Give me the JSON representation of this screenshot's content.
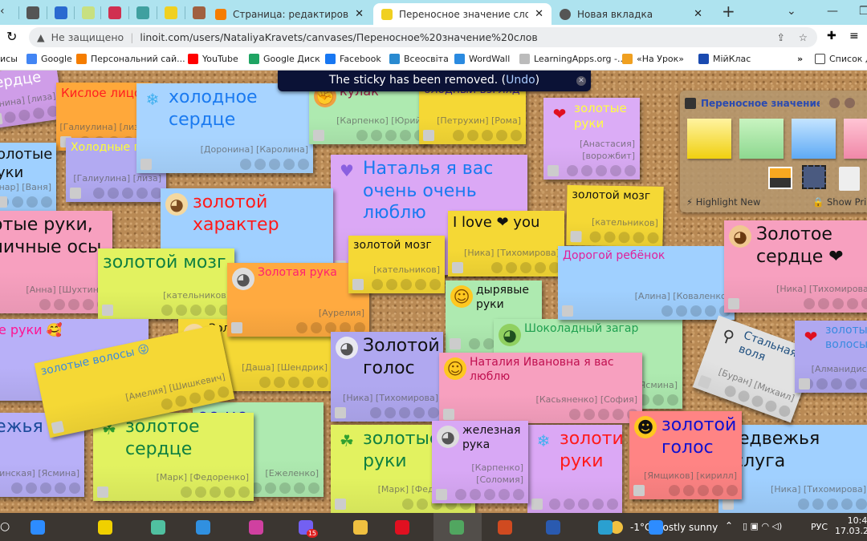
{
  "browser": {
    "pinned_tabs": [
      {
        "icon": "globe",
        "color": "#555"
      },
      {
        "icon": "app-blue",
        "color": "#2a6ad0"
      },
      {
        "icon": "flower",
        "color": "#c8e080"
      },
      {
        "icon": "chart",
        "color": "#d03050"
      },
      {
        "icon": "ribbon",
        "color": "#40a0a0"
      },
      {
        "icon": "linoit",
        "color": "#f0d020"
      },
      {
        "icon": "people",
        "color": "#a06040"
      }
    ],
    "tabs": [
      {
        "title": "Страница: редактирование",
        "icon": "blogger",
        "color": "#f57d00"
      },
      {
        "title": "Переносное значение слов - linoit",
        "icon": "linoit",
        "color": "#f0d020",
        "active": true
      },
      {
        "title": "Новая вкладка",
        "icon": "chrome",
        "color": "#555"
      }
    ],
    "new_tab": "+",
    "security": "Не защищено",
    "url": "linoit.com/users/NataliyaKravets/canvases/Переносное%20значение%20слов",
    "bookmarks": [
      {
        "label": "исы",
        "color": ""
      },
      {
        "label": "Google",
        "color": "#4285f4"
      },
      {
        "label": "Персональний сай...",
        "color": "#f57d00"
      },
      {
        "label": "YouTube",
        "color": "#ff0000"
      },
      {
        "label": "Google Диск",
        "color": "#1fa463"
      },
      {
        "label": "Facebook",
        "color": "#1877f2"
      },
      {
        "label": "Всеосвіта",
        "color": "#2a8ad0"
      },
      {
        "label": "WordWall",
        "color": "#2a8ae0"
      },
      {
        "label": "LearningApps.org -...",
        "color": "#bbb"
      },
      {
        "label": "«На Урок»",
        "color": "#f0a020"
      },
      {
        "label": "МійКлас",
        "color": "#1a4ab0"
      }
    ],
    "more": "»",
    "reading_list": "Список д"
  },
  "toast": {
    "message": "The sticky has been removed. (",
    "undo": "Undo",
    ")": ")"
  },
  "panel": {
    "title": "Переносное значение слов",
    "swatches": [
      "#f7e35a",
      "#a4e6a4",
      "#8ec8ff",
      "#f59ab6"
    ],
    "highlight": "Highlight New",
    "show_private": "Show Pri"
  },
  "board": {
    "stickies": [
      {
        "text": "сердце",
        "author": "[нина] [лиза]",
        "bg": "#cf9de8",
        "color": "#ffffff",
        "icon": ""
      },
      {
        "text": "Кислое лицо",
        "author": "[Галиулина] [лиза]",
        "bg": "#ffa83a",
        "color": "#ff2020",
        "icon": ""
      },
      {
        "text": "олотые уки",
        "author": "[нар] [Ваня]",
        "bg": "#9fd0ff",
        "color": "#111111",
        "icon": ""
      },
      {
        "text": "Холодные г",
        "author": "[Галиулина] [лиза]",
        "bg": "#b2aaf2",
        "color": "#ffff33",
        "icon": ""
      },
      {
        "text": "холодное сердце",
        "author": "[Доронина] [Каролина]",
        "bg": "#a8d4ff",
        "color": "#1a7af0",
        "icon": "snowflake"
      },
      {
        "text": "кулак",
        "author": "[Карпенко] [Юрий]",
        "bg": "#aeeab0",
        "color": "#a0204a",
        "icon": "fist"
      },
      {
        "text": "олодный взгляд",
        "author": "[Петрухин] [Рома]",
        "bg": "#f5d835",
        "color": "#4020a0",
        "icon": ""
      },
      {
        "text": "золотые руки",
        "author": "[Анастасия] [ворожбит]",
        "bg": "#dbacf6",
        "color": "#ffff40",
        "icon": "heart"
      },
      {
        "text": "Наталья я вас очень очень люблю",
        "author": "",
        "bg": "#dba8f5",
        "color": "#1a7af0",
        "icon": "purple-heart"
      },
      {
        "text": "золотой характер",
        "author": "",
        "bg": "#a0d0ff",
        "color": "#ff1a1a",
        "icon": "dog"
      },
      {
        "text": "лотые руки, еничные осы",
        "author": "[Анна] [Шухтина]",
        "bg": "#f7a0bf",
        "color": "#111111",
        "icon": ""
      },
      {
        "text": "золотой мозг",
        "author": "[кательников]",
        "bg": "#e2f260",
        "color": "#108040",
        "icon": ""
      },
      {
        "text": "Зол",
        "author": "[Даша] [Шендрик]",
        "bg": "#f5d835",
        "color": "#111111",
        "icon": "dog"
      },
      {
        "text": "тые руки 🥰",
        "author": "",
        "bg": "#b8b0f8",
        "color": "#ff1493",
        "icon": ""
      },
      {
        "text": "Золотая рука",
        "author": "[Аурелия]",
        "bg": "#ffaa40",
        "color": "#ff2070",
        "icon": "cat"
      },
      {
        "text": "золотой мозг",
        "author": "[кательников]",
        "bg": "#f5d835",
        "color": "#111111",
        "icon": ""
      },
      {
        "text": "I love ❤ you",
        "author": "[Ника] [Тихомирова]",
        "bg": "#f5d835",
        "color": "#111111",
        "icon": ""
      },
      {
        "text": "золотой мозг",
        "author": "[кательников]",
        "bg": "#f5d835",
        "color": "#111111",
        "icon": ""
      },
      {
        "text": "дырявые руки",
        "author": "[Ла",
        "bg": "#aeeab0",
        "color": "#111111",
        "icon": "smiley"
      },
      {
        "text": "Шоколадный загар",
        "author": "[Ясмина]",
        "bg": "#aeeab0",
        "color": "#20a050",
        "icon": "frog"
      },
      {
        "text": "Дорогой ребёнок",
        "author": "[Алина] [Коваленко]",
        "bg": "#a0d0ff",
        "color": "#e0209a",
        "icon": ""
      },
      {
        "text": "Золотое сердце ❤",
        "author": "[Ника] [Тихомирова]",
        "bg": "#f7a0bf",
        "color": "#111111",
        "icon": "horse"
      },
      {
        "text": "Золотой голос",
        "author": "[Ника] [Тихомирова]",
        "bg": "#b0a8f0",
        "color": "#111111",
        "icon": "mouse"
      },
      {
        "text": "Наталия Ивановна я вас люблю",
        "author": "[Касьяненко] [София]",
        "bg": "#f7a0bf",
        "color": "#c01050",
        "icon": "smiley"
      },
      {
        "text": "ое це",
        "author": "[Ежеленко]",
        "bg": "#aeeab0",
        "color": "#1010d0",
        "icon": ""
      },
      {
        "text": "золотое сердце",
        "author": "[Марк] [Федоренко]",
        "bg": "#e2f260",
        "color": "#108040",
        "icon": "clover"
      },
      {
        "text": "двежья уга",
        "author": "[инская] [Ясмина]",
        "bg": "#b8b0f8",
        "color": "#1a4a9a",
        "icon": ""
      },
      {
        "text": "золотые волосы 😜",
        "author": "[Амелия] [Шишкевич]",
        "bg": "#f5d835",
        "color": "#3a8ae0",
        "icon": ""
      },
      {
        "text": "золотые руки",
        "author": "[Марк] [Федоренко]",
        "bg": "#e2f260",
        "color": "#108040",
        "icon": "clover"
      },
      {
        "text": "золотие руки",
        "author": "",
        "bg": "#dba8f5",
        "color": "#ff1a1a",
        "icon": "snowflake"
      },
      {
        "text": "железная рука",
        "author": "[Карпенко] [Соломия]",
        "bg": "#d8a8f5",
        "color": "#111111",
        "icon": "cat"
      },
      {
        "text": "Медвежья услуга",
        "author": "[Ника] [Тихомирова]",
        "bg": "#a0d0ff",
        "color": "#111111",
        "icon": ""
      },
      {
        "text": "золотой голос",
        "author": "[Ямщиков] [кирилл]",
        "bg": "#ff8484",
        "color": "#1010d0",
        "icon": "sunglasses"
      },
      {
        "text": "Стальная воля",
        "author": "[Буран] [Михаил]",
        "bg": "#e2e2e2",
        "color": "#205080",
        "icon": "bicycle"
      },
      {
        "text": "золотые волосы",
        "author": "[Алманидис]",
        "bg": "#b0a8f0",
        "color": "#3a8ae0",
        "icon": "heart"
      }
    ]
  },
  "taskbar": {
    "apps": [
      {
        "icon": "zoom",
        "color": "#2d8cff"
      },
      {
        "icon": "diamond",
        "color": "#f0d000"
      },
      {
        "icon": "cat-app",
        "color": "#50c0a0"
      },
      {
        "icon": "notes",
        "color": "#3090e0"
      },
      {
        "icon": "drop",
        "color": "#d040a0"
      },
      {
        "icon": "viber",
        "color": "#7360f2",
        "badge": "15"
      },
      {
        "icon": "folder",
        "color": "#f0c040"
      },
      {
        "icon": "opera",
        "color": "#e01020"
      },
      {
        "icon": "chrome",
        "color": "#3a9a4a"
      },
      {
        "icon": "powerpoint",
        "color": "#d04a20"
      },
      {
        "icon": "word",
        "color": "#2a5ab0"
      },
      {
        "icon": "edge",
        "color": "#2aa0d0"
      },
      {
        "icon": "zoom",
        "color": "#2d8cff"
      }
    ],
    "weather": "-1°C  Mostly sunny",
    "lang": "РУС",
    "time": "10:49",
    "date": "17.03.2022"
  }
}
